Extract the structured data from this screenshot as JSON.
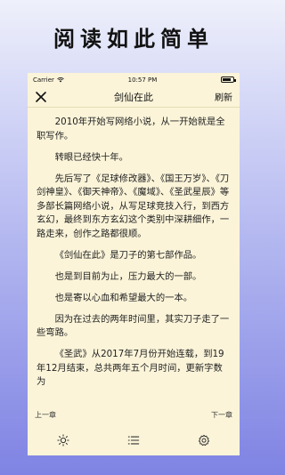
{
  "promo": {
    "title": "阅读如此简单"
  },
  "statusbar": {
    "carrier": "Carrier",
    "time": "10:57 PM",
    "battery_level": 0.85
  },
  "navbar": {
    "title": "剑仙在此",
    "refresh_label": "刷新",
    "close_icon": "close-icon"
  },
  "content": {
    "paragraphs": [
      "2010年开始写网络小说，从一开始就是全职写作。",
      "转眼已经快十年。",
      "先后写了《足球修改器》、《国王万岁》、《刀剑神皇》、《御天神帝》、《魔域》、《圣武星辰》等多部长篇网络小说，从写足球竞技入行，到西方玄幻，最终到东方玄幻这个类别中深耕细作，一路走来，创作之路都很顺。",
      "《剑仙在此》是刀子的第七部作品。",
      "也是到目前为止，压力最大的一部。",
      "也是寄以心血和希望最大的一本。",
      "因为在过去的两年时间里，其实刀子走了一些弯路。",
      "《圣武》从2017年7月份开始连载，到19年12月结束，总共两年五个月时间，更新字数为"
    ]
  },
  "chapter_nav": {
    "prev_label": "上一章",
    "next_label": "下一章"
  },
  "toolbar": {
    "icons": [
      "brightness-icon",
      "chapter-list-icon",
      "settings-icon"
    ]
  }
}
